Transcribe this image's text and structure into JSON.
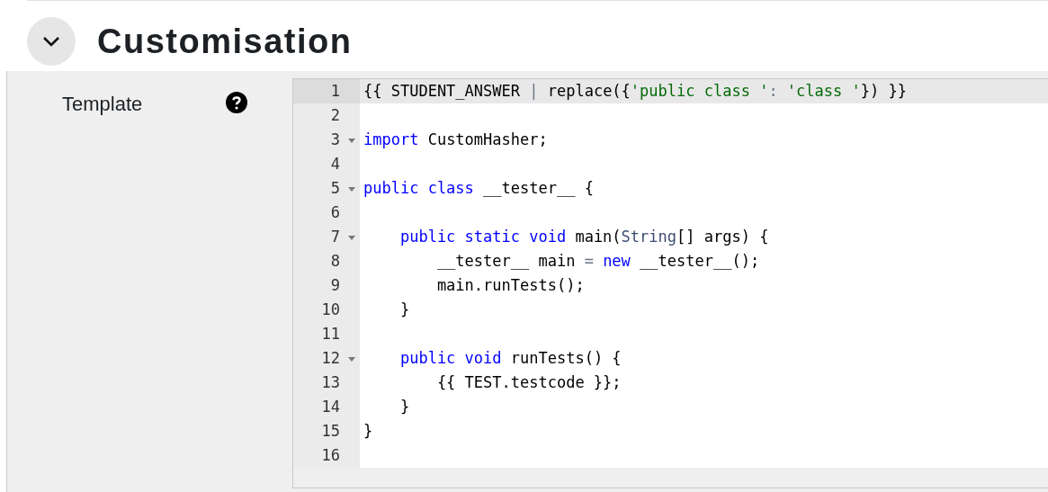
{
  "section": {
    "title": "Customisation",
    "expanded": true
  },
  "field": {
    "label": "Template"
  },
  "editor": {
    "lines": [
      {
        "number": "1",
        "foldable": false,
        "active": true,
        "tokens": [
          {
            "text": "{{ STUDENT_ANSWER ",
            "kind": "plain"
          },
          {
            "text": "|",
            "kind": "operator"
          },
          {
            "text": " replace({",
            "kind": "plain"
          },
          {
            "text": "'public class '",
            "kind": "string"
          },
          {
            "text": ": ",
            "kind": "operator"
          },
          {
            "text": "'class '",
            "kind": "string"
          },
          {
            "text": "}) }}",
            "kind": "plain"
          }
        ]
      },
      {
        "number": "2",
        "foldable": false,
        "active": false
      },
      {
        "number": "3",
        "foldable": true,
        "active": false,
        "tokens": [
          {
            "text": "import",
            "kind": "keyword"
          },
          {
            "text": " CustomHasher;",
            "kind": "plain"
          }
        ]
      },
      {
        "number": "4",
        "foldable": false,
        "active": false
      },
      {
        "number": "5",
        "foldable": true,
        "active": false,
        "tokens": [
          {
            "text": "public class",
            "kind": "keyword"
          },
          {
            "text": " __tester__ {",
            "kind": "plain"
          }
        ]
      },
      {
        "number": "6",
        "foldable": false,
        "active": false
      },
      {
        "number": "7",
        "foldable": true,
        "active": false,
        "tokens": [
          {
            "text": "    public static void",
            "kind": "keyword"
          },
          {
            "text": " main(",
            "kind": "plain"
          },
          {
            "text": "String",
            "kind": "type"
          },
          {
            "text": "[] args) {",
            "kind": "plain"
          }
        ]
      },
      {
        "number": "8",
        "foldable": false,
        "active": false,
        "tokens": [
          {
            "text": "        __tester__ main ",
            "kind": "plain"
          },
          {
            "text": "=",
            "kind": "operator"
          },
          {
            "text": " new",
            "kind": "keyword"
          },
          {
            "text": " __tester__();",
            "kind": "plain"
          }
        ]
      },
      {
        "number": "9",
        "foldable": false,
        "active": false,
        "tokens": [
          {
            "text": "        main.runTests();",
            "kind": "plain"
          }
        ]
      },
      {
        "number": "10",
        "foldable": false,
        "active": false,
        "tokens": [
          {
            "text": "    }",
            "kind": "plain"
          }
        ]
      },
      {
        "number": "11",
        "foldable": false,
        "active": false
      },
      {
        "number": "12",
        "foldable": true,
        "active": false,
        "tokens": [
          {
            "text": "    public void",
            "kind": "keyword"
          },
          {
            "text": " runTests() {",
            "kind": "plain"
          }
        ]
      },
      {
        "number": "13",
        "foldable": false,
        "active": false,
        "tokens": [
          {
            "text": "        {{ TEST.testcode }};",
            "kind": "plain"
          }
        ]
      },
      {
        "number": "14",
        "foldable": false,
        "active": false,
        "tokens": [
          {
            "text": "    }",
            "kind": "plain"
          }
        ]
      },
      {
        "number": "15",
        "foldable": false,
        "active": false,
        "tokens": [
          {
            "text": "}",
            "kind": "plain"
          }
        ]
      },
      {
        "number": "16",
        "foldable": false,
        "active": false
      }
    ]
  }
}
